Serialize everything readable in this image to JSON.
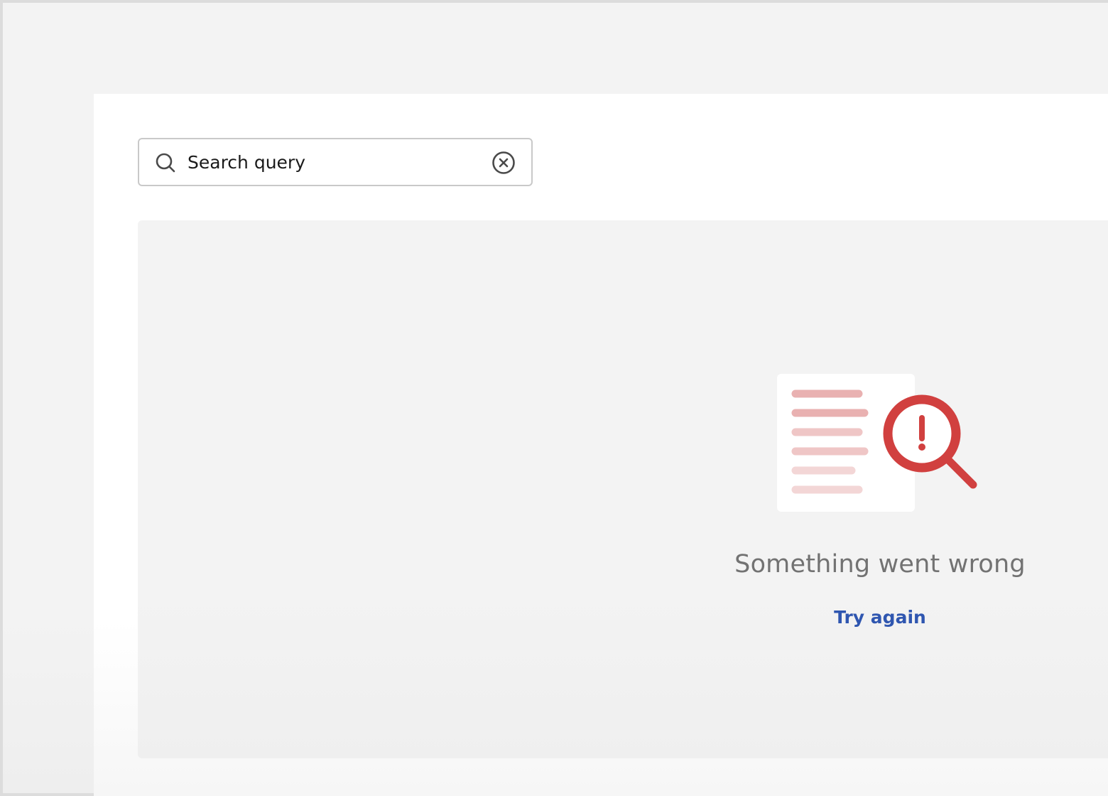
{
  "search": {
    "value": "Search query",
    "placeholder": "Search query",
    "icon": "search-icon",
    "clear_icon": "clear-circle-x-icon"
  },
  "error_state": {
    "illustration": "document-magnifier-error-icon",
    "title": "Something went wrong",
    "retry_label": "Try again"
  },
  "colors": {
    "accent_link": "#2f56b0",
    "error_red": "#d1403f",
    "muted_text": "#727272"
  }
}
